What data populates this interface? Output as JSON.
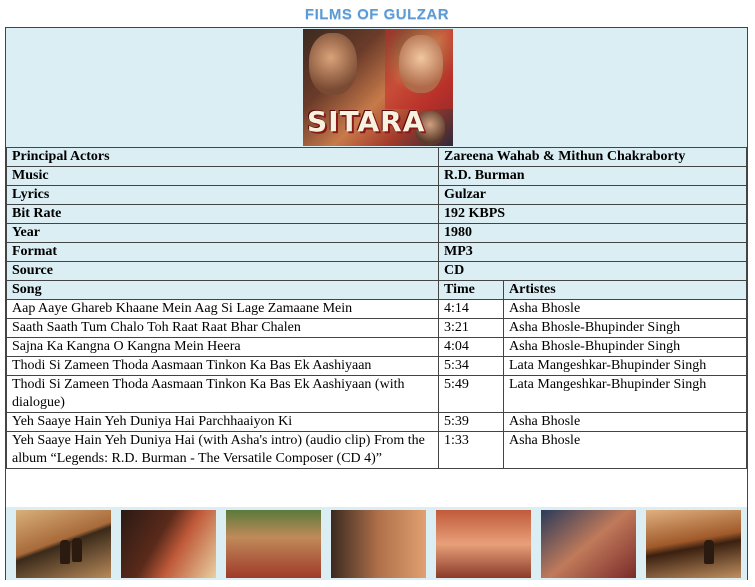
{
  "banner": {
    "title": "FILMS OF GULZAR"
  },
  "poster": {
    "title": "SITARA"
  },
  "info": [
    {
      "label": "Principal Actors",
      "value": "Zareena Wahab & Mithun Chakraborty"
    },
    {
      "label": "Music",
      "value": "R.D. Burman"
    },
    {
      "label": "Lyrics",
      "value": "Gulzar"
    },
    {
      "label": "Bit Rate",
      "value": "192 KBPS"
    },
    {
      "label": "Year",
      "value": "1980"
    },
    {
      "label": "Format",
      "value": "MP3"
    },
    {
      "label": "Source",
      "value": "CD"
    }
  ],
  "songs_header": {
    "song": "Song",
    "time": "Time",
    "artistes": "Artistes"
  },
  "songs": [
    {
      "title": "Aap Aaye Ghareb Khaane Mein Aag Si Lage Zamaane Mein",
      "time": "4:14",
      "artistes": "Asha Bhosle"
    },
    {
      "title": "Saath Saath Tum Chalo Toh Raat Raat Bhar Chalen",
      "time": "3:21",
      "artistes": "Asha Bhosle-Bhupinder Singh"
    },
    {
      "title": "Sajna Ka Kangna O Kangna Mein Heera",
      "time": "4:04",
      "artistes": "Asha Bhosle-Bhupinder Singh"
    },
    {
      "title": "Thodi Si Zameen Thoda Aasmaan Tinkon Ka Bas Ek Aashiyaan",
      "time": "5:34",
      "artistes": "Lata Mangeshkar-Bhupinder Singh"
    },
    {
      "title": "Thodi Si Zameen Thoda Aasmaan Tinkon Ka Bas Ek Aashiyaan (with dialogue)",
      "time": "5:49",
      "artistes": "Lata Mangeshkar-Bhupinder Singh"
    },
    {
      "title": "Yeh Saaye Hain Yeh Duniya Hai Parchhaaiyon Ki",
      "time": "5:39",
      "artistes": "Asha Bhosle"
    },
    {
      "title": "Yeh Saaye Hain Yeh Duniya Hai (with Asha's intro) (audio clip) From the album “Legends: R.D. Burman - The Versatile Composer (CD 4)”",
      "time": "1:33",
      "artistes": "Asha Bhosle"
    }
  ]
}
